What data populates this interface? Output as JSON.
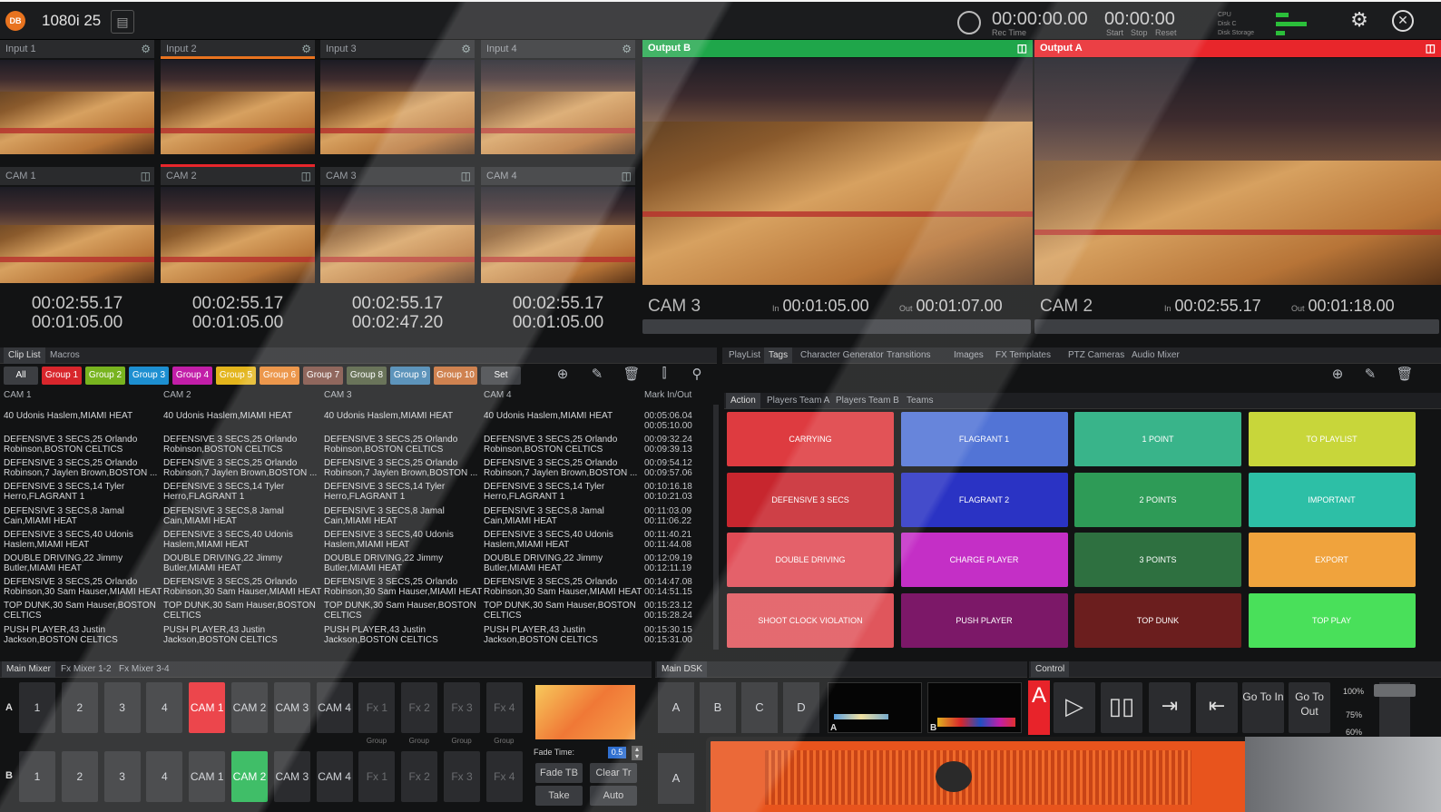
{
  "topbar": {
    "logo": "DB",
    "format": "1080i 25",
    "rec_time": "00:00:00.00",
    "rec_time_label": "Rec Time",
    "clock": "00:00:00",
    "start_label": "Start",
    "stop_label": "Stop",
    "reset_label": "Reset",
    "cpu_label": "CPU",
    "disk_c_label": "Disk C",
    "disk_storage_label": "Disk Storage",
    "settings_icon": "gear-icon",
    "close_icon": "close-icon"
  },
  "inputs": [
    {
      "head": "Input 1",
      "cam": "CAM 1",
      "tc1": "00:02:55.17",
      "tc2": "00:01:05.00"
    },
    {
      "head": "Input 2",
      "cam": "CAM 2",
      "tc1": "00:02:55.17",
      "tc2": "00:01:05.00"
    },
    {
      "head": "Input 3",
      "cam": "CAM 3",
      "tc1": "00:02:55.17",
      "tc2": "00:02:47.20"
    },
    {
      "head": "Input 4",
      "cam": "CAM 4",
      "tc1": "00:02:55.17",
      "tc2": "00:01:05.00"
    }
  ],
  "outputs": {
    "b": {
      "head": "Output B",
      "cam": "CAM 3",
      "in_label": "In",
      "in": "00:01:05.00",
      "out_label": "Out",
      "out": "00:01:07.00",
      "color": "#1fa64a"
    },
    "a": {
      "head": "Output A",
      "cam": "CAM 2",
      "in_label": "In",
      "in": "00:02:55.17",
      "out_label": "Out",
      "out": "00:01:18.00",
      "color": "#e8262b"
    }
  },
  "clip_tabs": [
    "Clip List",
    "Macros"
  ],
  "groups": [
    {
      "label": "All",
      "color": "#3c3e42"
    },
    {
      "label": "Group 1",
      "color": "#d8262c"
    },
    {
      "label": "Group 2",
      "color": "#78b41f"
    },
    {
      "label": "Group 3",
      "color": "#1d8fd1"
    },
    {
      "label": "Group 4",
      "color": "#c21ea8"
    },
    {
      "label": "Group 5",
      "color": "#e3b51c"
    },
    {
      "label": "Group 6",
      "color": "#e8832a"
    },
    {
      "label": "Group 7",
      "color": "#7b4a3e"
    },
    {
      "label": "Group 8",
      "color": "#4d5a3a"
    },
    {
      "label": "Group 9",
      "color": "#3e7fae"
    },
    {
      "label": "Group 10",
      "color": "#c66a2f"
    },
    {
      "label": "Set",
      "color": "#3c3e42"
    }
  ],
  "clip_columns": [
    "CAM 1",
    "CAM 2",
    "CAM 3",
    "CAM 4",
    "Mark In/Out"
  ],
  "clips": [
    {
      "l1": "40 Udonis Haslem,MIAMI HEAT",
      "l2": "",
      "m1": "00:05:06.04",
      "m2": "00:05:10.00"
    },
    {
      "l1": "DEFENSIVE 3 SECS,25 Orlando",
      "l2": "Robinson,BOSTON CELTICS",
      "m1": "00:09:32.24",
      "m2": "00:09:39.13"
    },
    {
      "l1": "DEFENSIVE 3 SECS,25 Orlando",
      "l2": "Robinson,7 Jaylen Brown,BOSTON ...",
      "m1": "00:09:54.12",
      "m2": "00:09:57.06"
    },
    {
      "l1": "DEFENSIVE 3 SECS,14 Tyler",
      "l2": "Herro,FLAGRANT 1",
      "m1": "00:10:16.18",
      "m2": "00:10:21.03"
    },
    {
      "l1": "DEFENSIVE 3 SECS,8 Jamal",
      "l2": "Cain,MIAMI HEAT",
      "m1": "00:11:03.09",
      "m2": "00:11:06.22"
    },
    {
      "l1": "DEFENSIVE 3 SECS,40 Udonis",
      "l2": "Haslem,MIAMI HEAT",
      "m1": "00:11:40.21",
      "m2": "00:11:44.08"
    },
    {
      "l1": "DOUBLE DRIVING,22 Jimmy",
      "l2": "Butler,MIAMI HEAT",
      "m1": "00:12:09.19",
      "m2": "00:12:11.19"
    },
    {
      "l1": "DEFENSIVE 3 SECS,25 Orlando",
      "l2": "Robinson,30 Sam Hauser,MIAMI HEAT",
      "m1": "00:14:47.08",
      "m2": "00:14:51.15"
    },
    {
      "l1": "TOP DUNK,30 Sam Hauser,BOSTON",
      "l2": "CELTICS",
      "m1": "00:15:23.12",
      "m2": "00:15:28.24"
    },
    {
      "l1": "PUSH PLAYER,43 Justin",
      "l2": "Jackson,BOSTON CELTICS",
      "m1": "00:15:30.15",
      "m2": "00:15:31.00"
    }
  ],
  "right_tabs": [
    "PlayList",
    "Tags",
    "Character Generator",
    "Transitions",
    "Images",
    "FX Templates",
    "PTZ Cameras",
    "Audio Mixer"
  ],
  "tag_tabs": [
    "Action",
    "Players Team A",
    "Players Team B",
    "Teams"
  ],
  "tags": [
    {
      "label": "CARRYING",
      "color": "#de3b40"
    },
    {
      "label": "FLAGRANT 1",
      "color": "#5274d6"
    },
    {
      "label": "1 POINT",
      "color": "#39b48a"
    },
    {
      "label": "TO PLAYLIST",
      "color": "#c8d63a"
    },
    {
      "label": "DEFENSIVE 3 SECS",
      "color": "#c7262e"
    },
    {
      "label": "FLAGRANT 2",
      "color": "#2a33c4"
    },
    {
      "label": "2 POINTS",
      "color": "#2e9b57"
    },
    {
      "label": "IMPORTANT",
      "color": "#2dbfa6"
    },
    {
      "label": "DOUBLE DRIVING",
      "color": "#e04b55"
    },
    {
      "label": "CHARGE PLAYER",
      "color": "#c42fc6"
    },
    {
      "label": "3 POINTS",
      "color": "#2e7040"
    },
    {
      "label": "EXPORT",
      "color": "#f0a33d"
    },
    {
      "label": "SHOOT CLOCK VIOLATION",
      "color": "#e0565c"
    },
    {
      "label": "PUSH PLAYER",
      "color": "#7c1868"
    },
    {
      "label": "TOP DUNK",
      "color": "#6b1e1e"
    },
    {
      "label": "TOP PLAY",
      "color": "#49e05a"
    }
  ],
  "mixer_tabs": [
    "Main Mixer",
    "Fx Mixer 1-2",
    "Fx Mixer 3-4"
  ],
  "mixer_row_a": {
    "label": "A",
    "buttons": [
      "1",
      "2",
      "3",
      "4",
      "CAM 1",
      "CAM 2",
      "CAM 3",
      "CAM 4",
      "Fx 1",
      "Fx 2",
      "Fx 3",
      "Fx 4"
    ]
  },
  "mixer_row_b": {
    "label": "B",
    "buttons": [
      "1",
      "2",
      "3",
      "4",
      "CAM 1",
      "CAM 2",
      "CAM 3",
      "CAM 4",
      "Fx 1",
      "Fx 2",
      "Fx 3",
      "Fx 4"
    ]
  },
  "group_small": [
    "Group",
    "Group",
    "Group",
    "Group"
  ],
  "fade": {
    "label": "Fade Time:",
    "value": "0.5",
    "fade_tb": "Fade TB",
    "clear_tr": "Clear Tr",
    "take": "Take",
    "auto": "Auto"
  },
  "dsk": {
    "title": "Main DSK",
    "buttons": [
      "A",
      "B",
      "C",
      "D"
    ],
    "row2": "A",
    "mon_a": "A",
    "mon_b": "B"
  },
  "control": {
    "title": "Control",
    "live": "A",
    "go_in": "Go To In",
    "go_out": "Go To Out",
    "go_to": "Go To",
    "pct": [
      "100%",
      "75%",
      "60%"
    ]
  }
}
